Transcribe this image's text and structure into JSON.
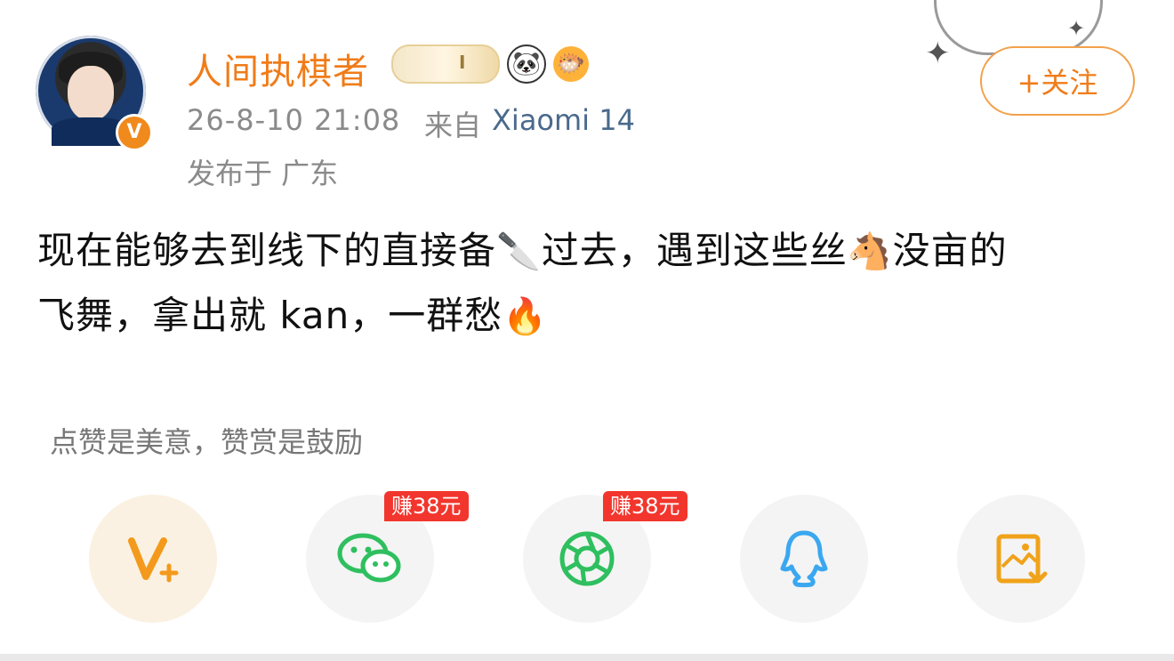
{
  "user": {
    "name": "人间执棋者",
    "verified_mark": "V",
    "badge_level": "I"
  },
  "post": {
    "time": "26-8-10 21:08",
    "source_prefix": "来自",
    "device": "Xiaomi 14",
    "location": "发布于 广东",
    "text_line1_a": "现在能够去到线下的直接备",
    "emoji_knife": "🔪",
    "text_line1_b": "过去，遇到这些丝",
    "emoji_horse": "🐴",
    "text_line1_c": "没亩的",
    "text_line2": "飞舞，拿出就 kan，一群愁",
    "emoji_fire": "🔥"
  },
  "actions": {
    "follow_label": "+关注"
  },
  "footer": {
    "hint": "点赞是美意，赞赏是鼓励",
    "share_items": [
      {
        "name": "vip-plus",
        "icon": "V+"
      },
      {
        "name": "wechat",
        "icon": "wechat-icon",
        "reward": "赚38元"
      },
      {
        "name": "moments",
        "icon": "moments-icon",
        "reward": "赚38元"
      },
      {
        "name": "qq",
        "icon": "qq-icon"
      },
      {
        "name": "save-image",
        "icon": "save-image-icon"
      }
    ]
  },
  "colors": {
    "brand_orange": "#f07c19",
    "reward_red": "#f2362d",
    "wechat_green": "#2fbf5f",
    "moments_green": "#2fbf5f",
    "qq_blue": "#3aa7f0",
    "save_orange": "#f0a21a"
  }
}
